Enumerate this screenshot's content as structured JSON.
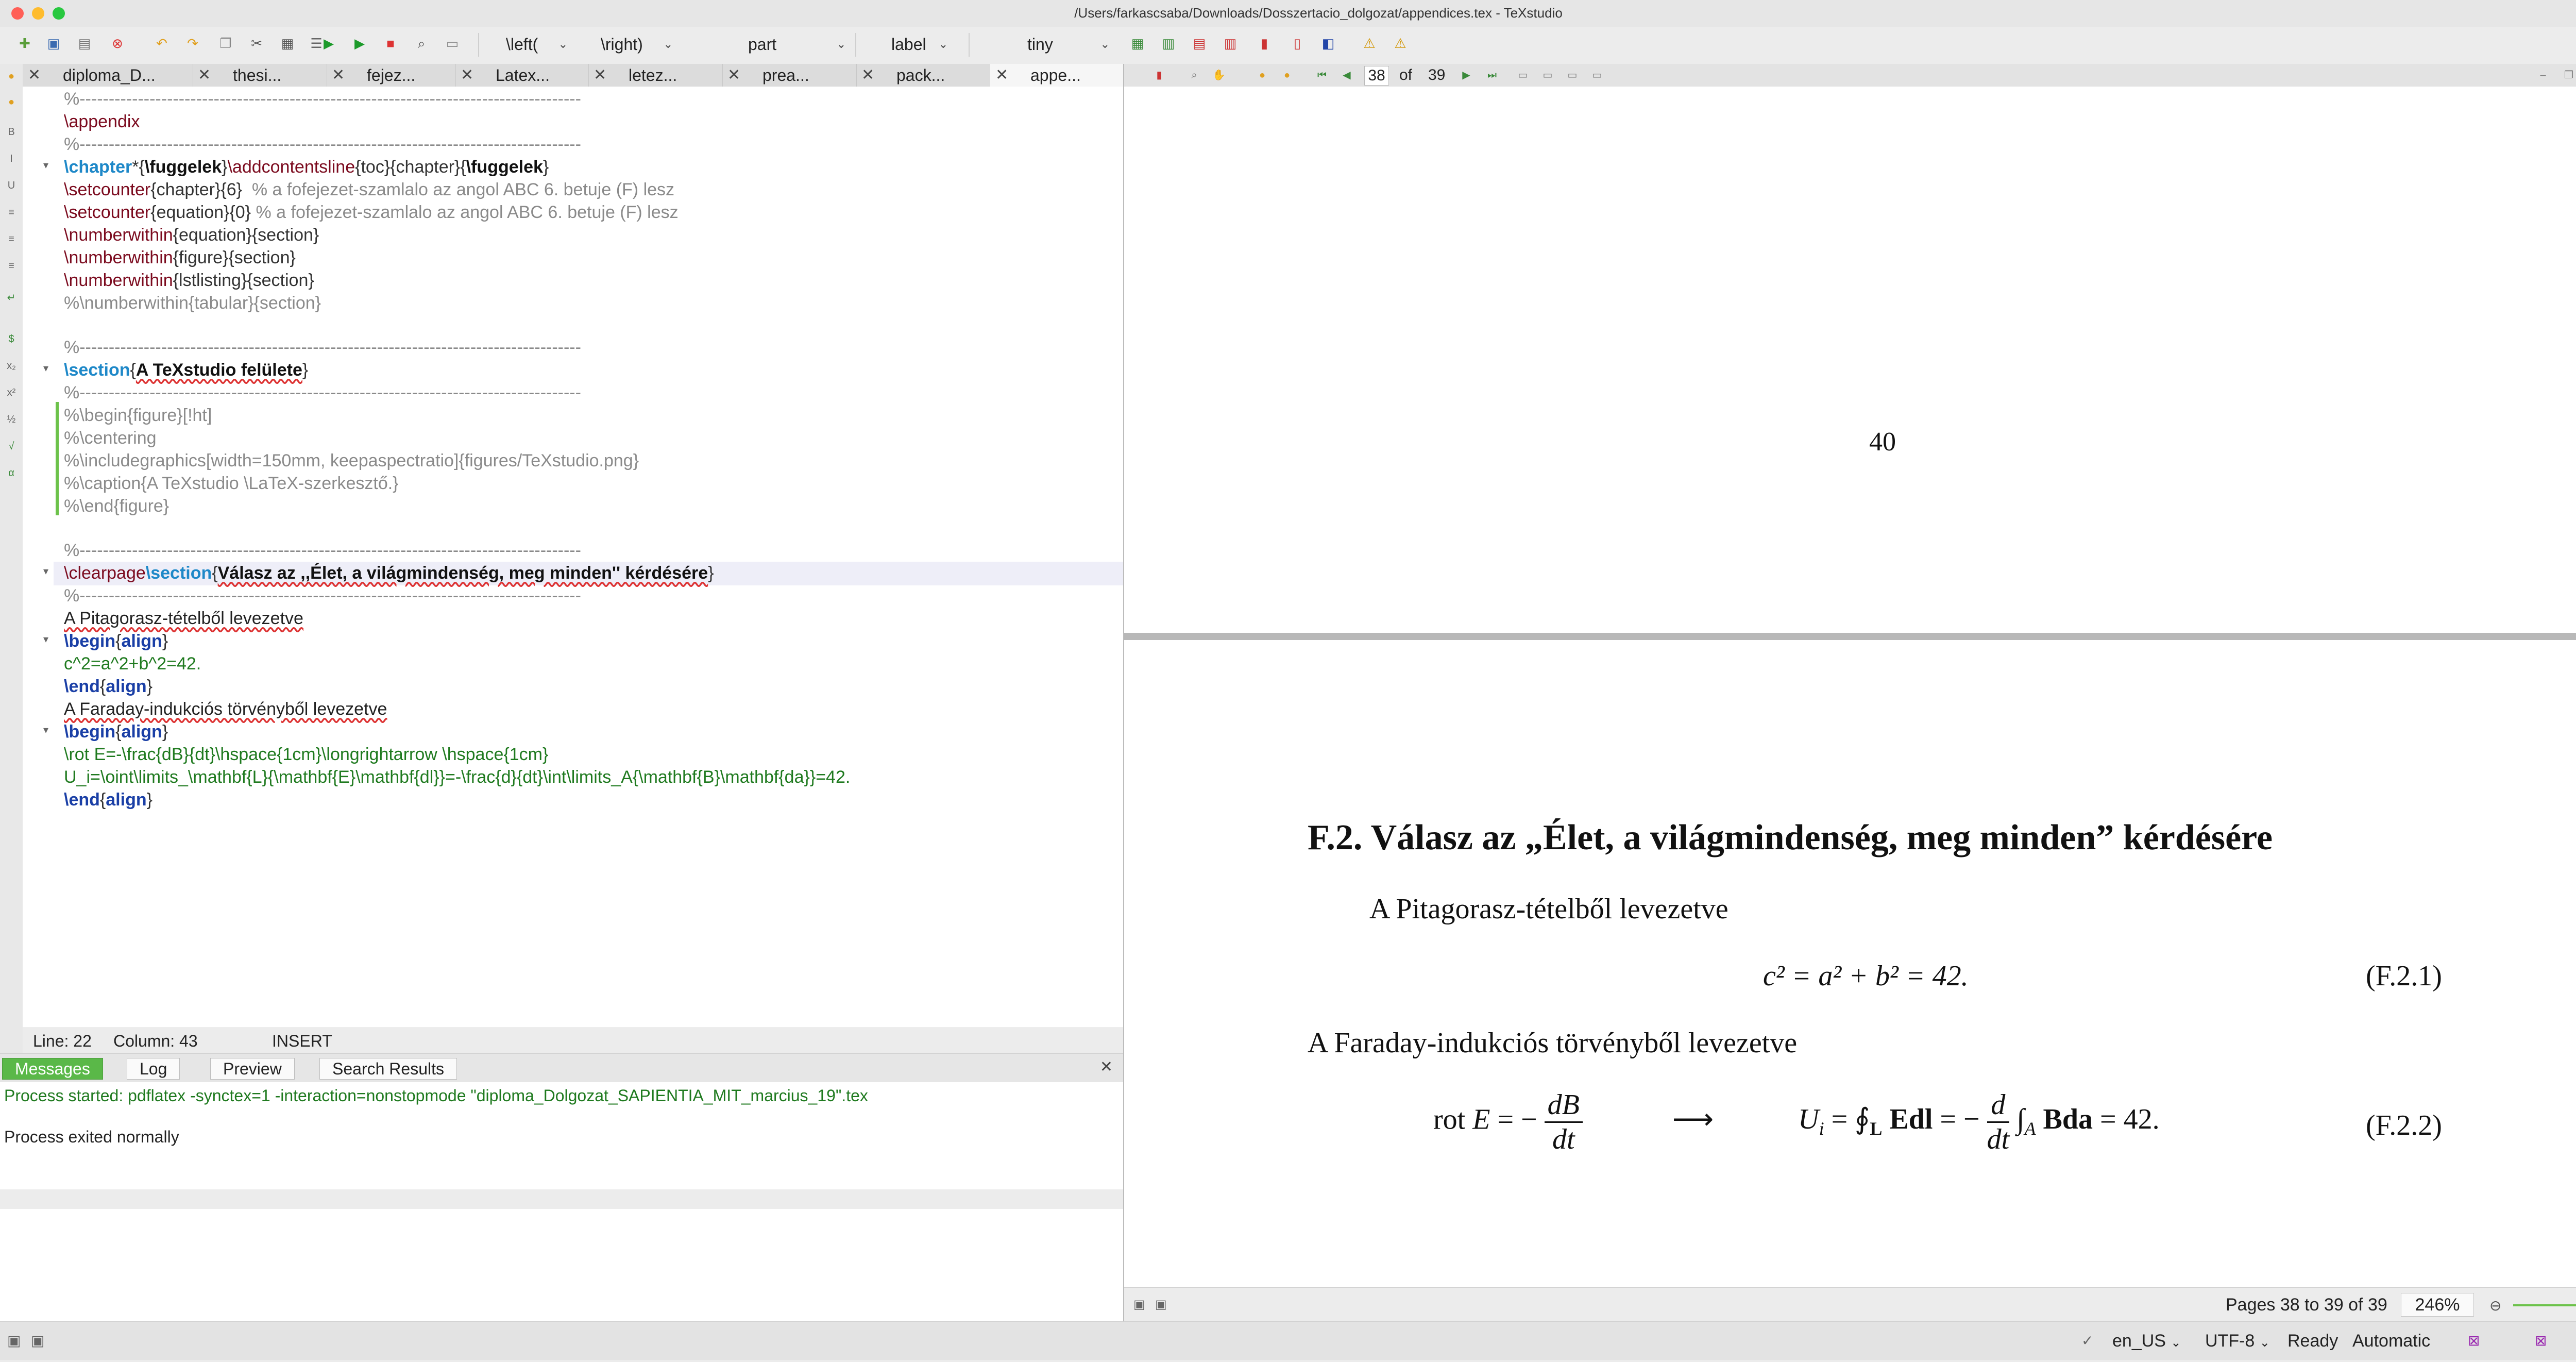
{
  "window": {
    "title": "/Users/farkascsaba/Downloads/Dosszertacio_dolgozat/appendices.tex - TeXstudio"
  },
  "toolbar": {
    "left_delim": "\\left(",
    "right_delim": "\\right)",
    "sectioning": "part",
    "label": "label",
    "size": "tiny"
  },
  "tabs": [
    {
      "label": "diploma_D..."
    },
    {
      "label": "thesi..."
    },
    {
      "label": "fejez..."
    },
    {
      "label": "Latex..."
    },
    {
      "label": "letez..."
    },
    {
      "label": "prea..."
    },
    {
      "label": "pack..."
    },
    {
      "label": "appe..."
    }
  ],
  "editor": {
    "lines": [
      [
        "%--------------------------------------------------------------------------------------"
      ],
      [
        "\\appendix"
      ],
      [
        "%--------------------------------------------------------------------------------------"
      ],
      [
        "\\chapter",
        "*{",
        "\\fuggelek",
        "}",
        "\\addcontentsline",
        "{toc}{chapter}{",
        "\\fuggelek",
        "}"
      ],
      [
        "\\setcounter",
        "{chapter}{6}",
        "  % a fofejezet-szamlalo az angol ABC 6. betuje (F) lesz"
      ],
      [
        "\\setcounter",
        "{equation}{0}",
        " % a fofejezet-szamlalo az angol ABC 6. betuje (F) lesz"
      ],
      [
        "\\numberwithin",
        "{equation}{section}"
      ],
      [
        "\\numberwithin",
        "{figure}{section}"
      ],
      [
        "\\numberwithin",
        "{lstlisting}{section}"
      ],
      [
        "%\\numberwithin{tabular}{section}"
      ],
      [
        "%--------------------------------------------------------------------------------------"
      ],
      [
        "\\section",
        "{",
        "A TeXstudio felülete",
        "}"
      ],
      [
        "%--------------------------------------------------------------------------------------"
      ],
      [
        "%\\begin{figure}[!ht]"
      ],
      [
        "%\\centering"
      ],
      [
        "%\\includegraphics[width=150mm, keepaspectratio]{figures/TeXstudio.png}"
      ],
      [
        "%\\caption{A TeXstudio \\LaTeX-szerkesztő.}"
      ],
      [
        "%\\end{figure}"
      ],
      [
        "%--------------------------------------------------------------------------------------"
      ],
      [
        "\\clearpage",
        "\\section",
        "{",
        "Válasz az ,,Élet, a világmindenség, meg minden'' kérdésére",
        "}"
      ],
      [
        "%--------------------------------------------------------------------------------------"
      ],
      [
        "A Pitagorasz-tételből levezetve"
      ],
      [
        "\\begin",
        "{",
        "align",
        "}"
      ],
      [
        "c^2=a^2+b^2=42."
      ],
      [
        "\\end",
        "{",
        "align",
        "}"
      ],
      [
        "A Faraday-indukciós törvényből levezetve"
      ],
      [
        "\\begin",
        "{",
        "align",
        "}"
      ],
      [
        "\\rot E=-\\frac{dB}{dt}\\hspace{1cm}\\longrightarrow \\hspace{1cm}"
      ],
      [
        "U_i=\\oint\\limits_\\mathbf{L}{\\mathbf{E}\\mathbf{dl}}=-\\frac{d}{dt}\\int\\limits_A{\\mathbf{B}\\mathbf{da}}=42."
      ],
      [
        "\\end",
        "{",
        "align",
        "}"
      ]
    ],
    "status": {
      "line": "Line: 22",
      "column": "Column: 43",
      "mode": "INSERT"
    }
  },
  "messages": {
    "tabs": [
      "Messages",
      "Log",
      "Preview",
      "Search Results"
    ],
    "line1": "Process started: pdflatex -synctex=1 -interaction=nonstopmode \"diploma_Dolgozat_SAPIENTIA_MIT_marcius_19\".tex",
    "line2": "Process exited normally"
  },
  "pdf": {
    "page_input": "38",
    "page_of": "of",
    "page_total": "39",
    "page_number": "40",
    "section_heading": "F.2.  Válasz az „Élet, a világmindenség, meg minden” kérdésére",
    "para1": "A Pitagorasz-tételből levezetve",
    "eq1": "c² = a² + b² = 42.",
    "eq1_tag": "(F.2.1)",
    "para2": "A Faraday-indukciós törvényből levezetve",
    "eq2_tag": "(F.2.2)",
    "pages_status": "Pages 38 to 39 of 39",
    "zoom": "246%"
  },
  "statusbar": {
    "language": "en_US",
    "encoding": "UTF-8",
    "state": "Ready",
    "mode": "Automatic"
  }
}
